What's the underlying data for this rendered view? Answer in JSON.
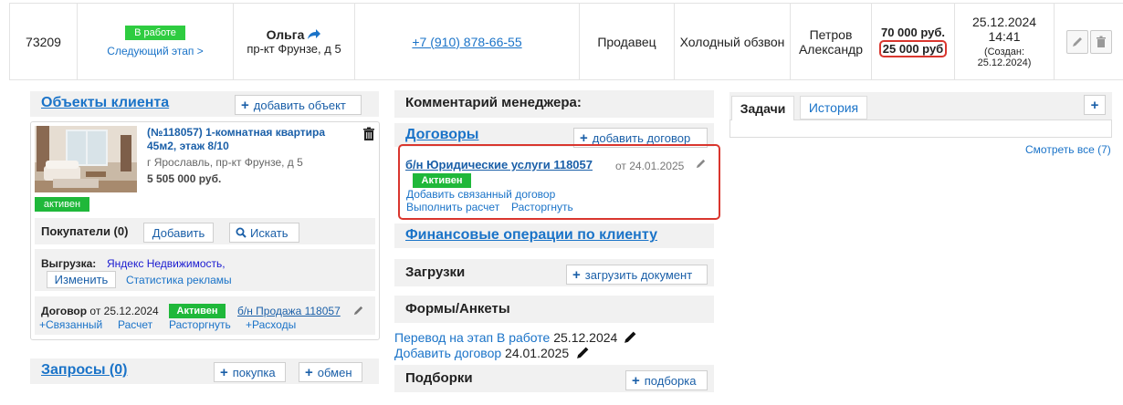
{
  "deal": {
    "id": "73209",
    "status_badge": "В работе",
    "next_stage": "Следующий этап >",
    "client_name": "Ольга",
    "client_address": "пр-кт Фрунзе, д 5",
    "phone": "+7 (910) 878-66-55",
    "role": "Продавец",
    "source": "Холодный обзвон",
    "manager_first": "Петров",
    "manager_last": "Александр",
    "price_main": "70 000 руб.",
    "price_second": "25 000 руб",
    "date": "25.12.2024",
    "time": "14:41",
    "created_label": "(Создан:",
    "created_date": "25.12.2024)"
  },
  "objects": {
    "title": "Объекты клиента",
    "add_label": "добавить объект",
    "item": {
      "title_line1": "(№118057) 1-комнатная квартира",
      "title_line2": "45м2, этаж 8/10",
      "address": "г Ярославль, пр-кт Фрунзе, д 5",
      "price": "5 505 000 руб.",
      "status": "активен",
      "buyers_label": "Покупатели (0)",
      "add_button": "Добавить",
      "search_button": "Искать",
      "export_label": "Выгрузка:",
      "export_target": "Яндекс Недвижимость,",
      "change_button": "Изменить",
      "ads_stats": "Статистика рекламы",
      "contract_label": "Договор",
      "contract_date": "от 25.12.2024",
      "contract_status": "Активен",
      "contract_link": "б/н Продажа 118057",
      "action_related": "+Связанный",
      "action_calc": "Расчет",
      "action_terminate": "Расторгнуть",
      "action_expenses": "+Расходы"
    }
  },
  "requests": {
    "title": "Запросы (0)",
    "buy_label": "покупка",
    "exchange_label": "обмен"
  },
  "middle": {
    "comment_title": "Комментарий менеджера:",
    "contracts_title": "Договоры",
    "add_contract": "добавить договор",
    "contract_link": "б/н Юридические услуги 118057",
    "contract_date": "от 24.01.2025",
    "contract_status": "Активен",
    "add_related": "Добавить связанный договор",
    "do_calc": "Выполнить расчет",
    "terminate": "Расторгнуть",
    "finance_title": "Финансовые операции по клиенту",
    "uploads_title": "Загрузки",
    "upload_doc": "загрузить документ",
    "forms_title": "Формы/Анкеты",
    "form1_link": "Перевод на этап В работе",
    "form1_date": "25.12.2024",
    "form2_link": "Добавить договор",
    "form2_date": "24.01.2025",
    "selections_title": "Подборки",
    "add_selection": "подборка"
  },
  "tasks": {
    "tab_tasks": "Задачи",
    "tab_history": "История",
    "see_all": "Смотреть все (7)"
  },
  "colors": {
    "accent": "#1a73c8",
    "green": "#1fb83a",
    "highlight": "#d9362e"
  }
}
